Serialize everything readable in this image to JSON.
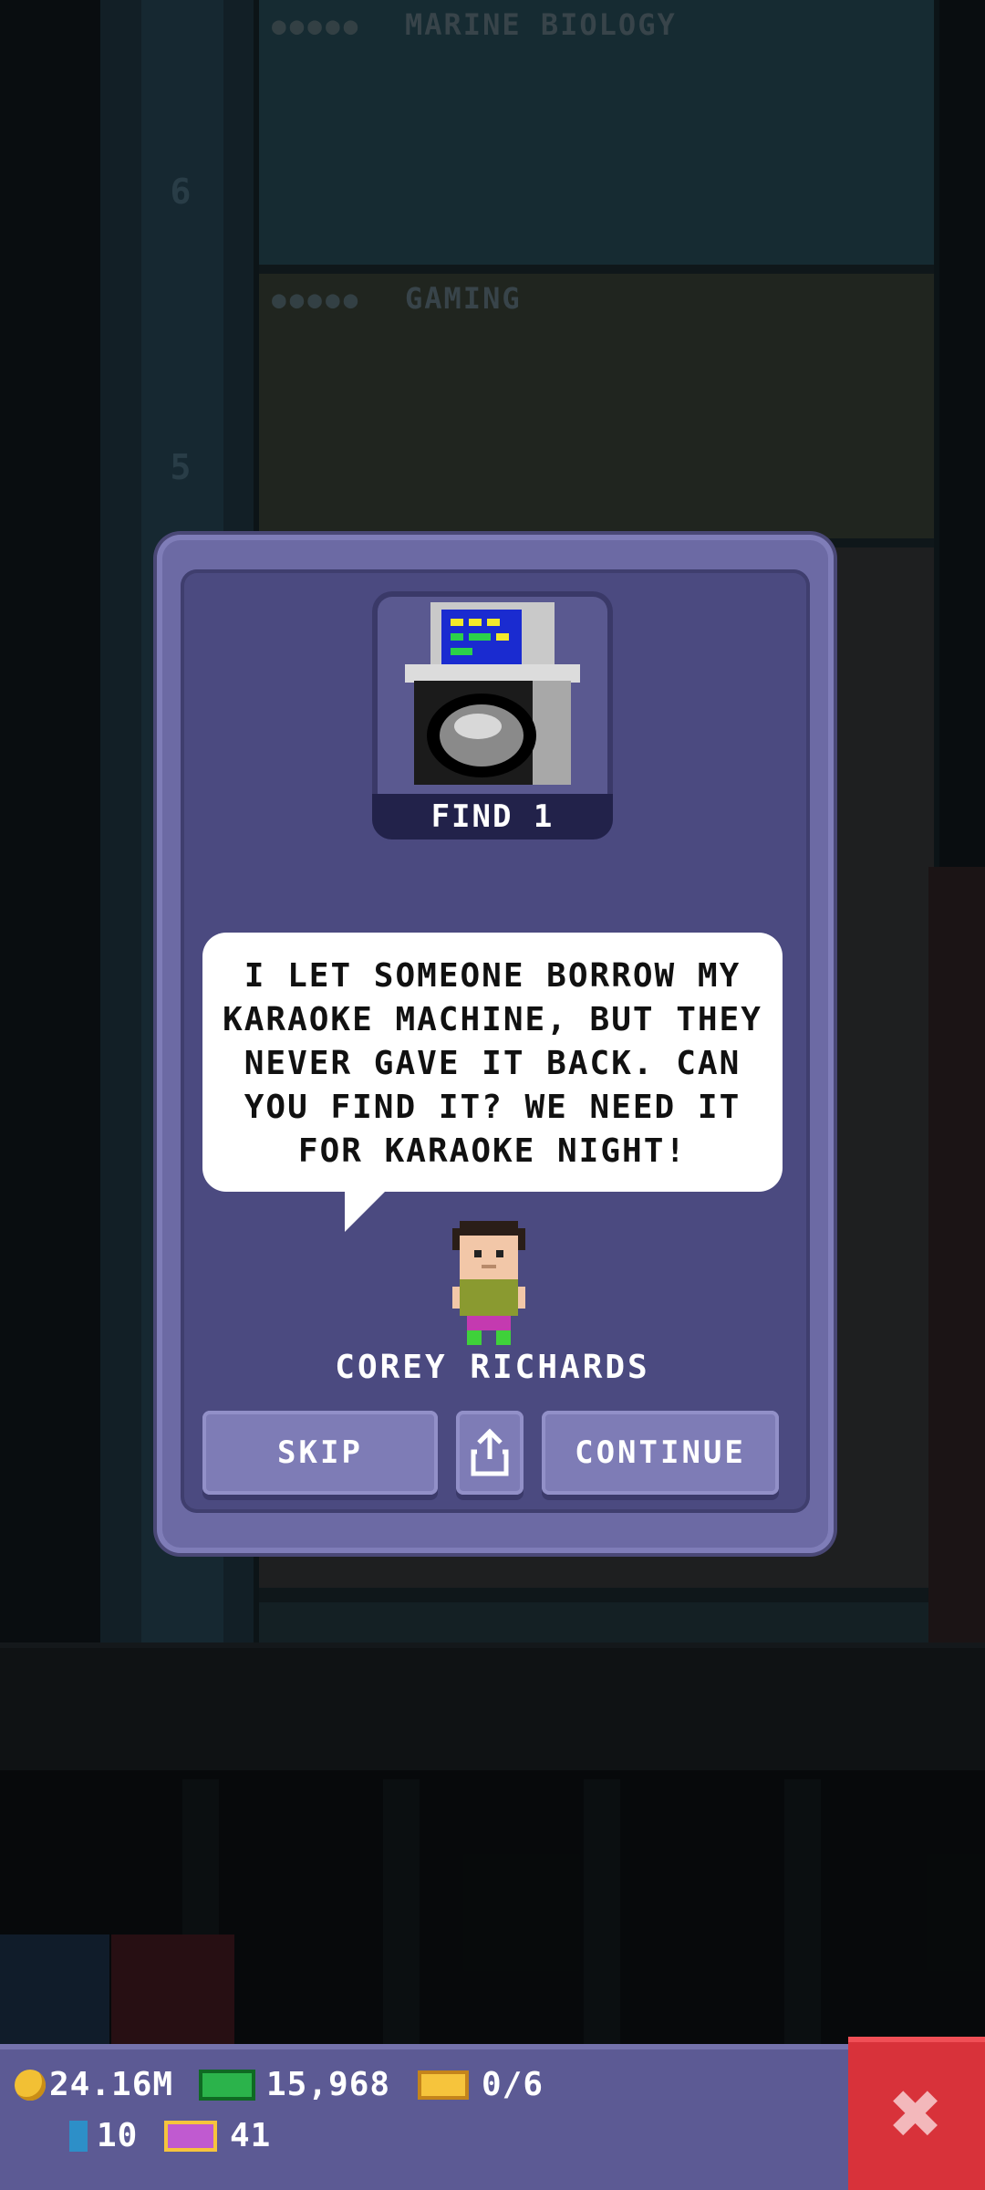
{
  "background": {
    "floors": [
      {
        "name": "MARINE BIOLOGY",
        "number": "6"
      },
      {
        "name": "GAMING",
        "number": "5"
      }
    ]
  },
  "quest_dialog": {
    "item_label": "FIND 1",
    "item_icon": "karaoke-machine-icon",
    "message": "I LET SOMEONE BORROW MY KARAOKE MACHINE, BUT THEY NEVER GAVE IT BACK. CAN YOU FIND IT? WE NEED IT FOR KARAOKE NIGHT!",
    "npc_name": "COREY RICHARDS",
    "buttons": {
      "skip": "SKIP",
      "share_icon": "share-icon",
      "continue": "CONTINUE"
    }
  },
  "status": {
    "coins": "24.16M",
    "bux": "15,968",
    "tickets": "0/6",
    "battery": "10",
    "vip": "41"
  },
  "colors": {
    "dialog_bg": "#6c6aa4",
    "dialog_inner": "#4b4a80",
    "close_red": "#d8323a"
  }
}
